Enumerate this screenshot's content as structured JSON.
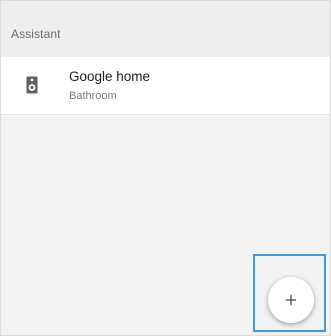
{
  "section": {
    "title": "Assistant"
  },
  "devices": [
    {
      "name": "Google home",
      "room": "Bathroom",
      "icon": "speaker-icon"
    }
  ],
  "fab": {
    "icon": "plus-icon"
  },
  "colors": {
    "highlight": "#3d9be6",
    "background": "#f2f2f2",
    "row_background": "#ffffff"
  }
}
